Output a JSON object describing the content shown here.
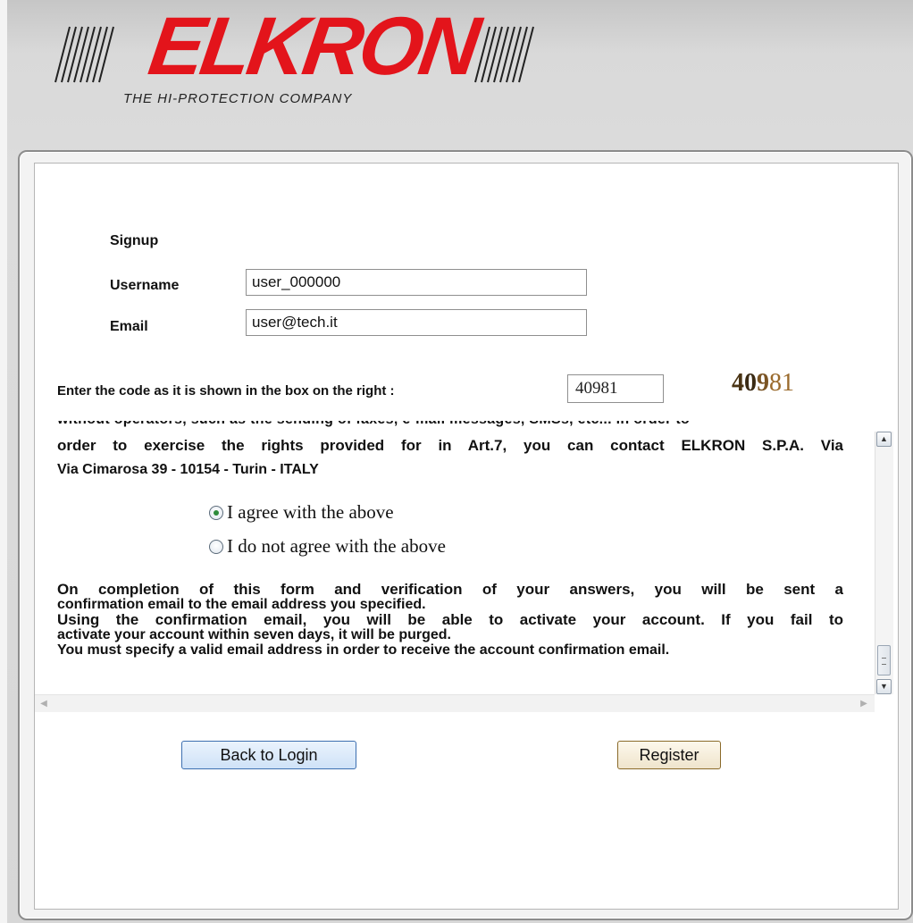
{
  "logo": {
    "brand": "ELKRON",
    "tagline": "THE HI-PROTECTION COMPANY",
    "brand_color": "#e3141b"
  },
  "form": {
    "title": "Signup",
    "username_label": "Username",
    "username_value": "user_000000",
    "email_label": "Email",
    "email_value": "user@tech.it",
    "code_label": "Enter the code as it is shown in the box on the right :",
    "code_value": "40981",
    "captcha": [
      "4",
      "0",
      "9",
      "81"
    ]
  },
  "terms": {
    "cut_line": "without operators, such as the sending of faxes, e-mail messages, SMSs, etc... in order to",
    "line2": "order to exercise the rights provided for in Art.7, you can contact ELKRON S.P.A. Via",
    "line3": "Via Cimarosa 39 - 10154 - Turin - ITALY",
    "agree_label": "I agree with the above",
    "disagree_label": "I do not agree with the above",
    "info1a": "On completion of this form and verification of your answers, you will be sent a",
    "info1b": "confirmation email to the email address you specified.",
    "info2a": "Using the confirmation email, you will be able to activate your account. If you fail to",
    "info2b": "activate your account within seven days, it will be purged.",
    "info3": "You must specify a valid email address in order to receive the account confirmation email."
  },
  "buttons": {
    "back": "Back to Login",
    "register": "Register"
  }
}
